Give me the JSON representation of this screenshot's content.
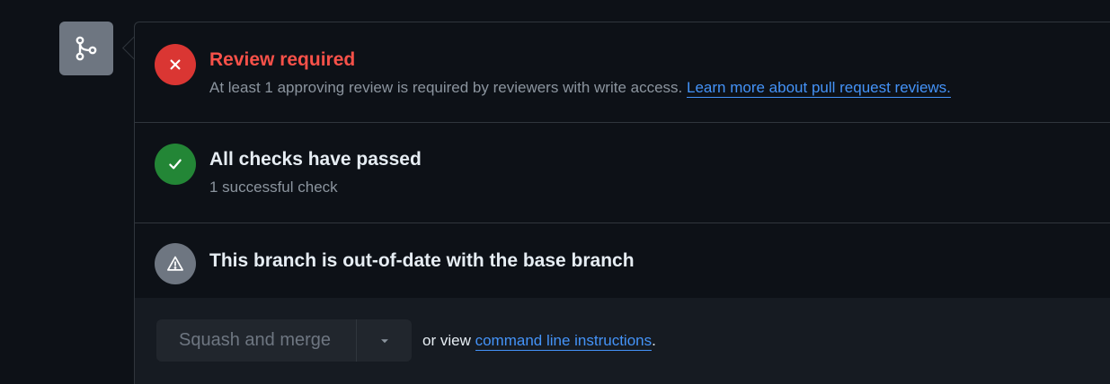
{
  "merge_box": {
    "icon": "git-merge-icon",
    "review": {
      "icon": "x-circle-icon",
      "title": "Review required",
      "description": "At least 1 approving review is required by reviewers with write access.",
      "link_text": "Learn more about pull request reviews."
    },
    "checks": {
      "icon": "check-circle-icon",
      "title": "All checks have passed",
      "description": "1 successful check"
    },
    "branch": {
      "icon": "alert-icon",
      "title": "This branch is out-of-date with the base branch"
    },
    "merge": {
      "button_label": "Squash and merge",
      "caret_icon": "triangle-down-icon",
      "help_prefix": "or view",
      "help_link": "command line instructions",
      "help_suffix": "."
    }
  },
  "colors": {
    "background": "#0d1117",
    "danger": "#da3633",
    "danger_text": "#f85149",
    "success": "#238636",
    "neutral": "#6e7681",
    "link": "#4493f8",
    "border": "#30363d"
  }
}
